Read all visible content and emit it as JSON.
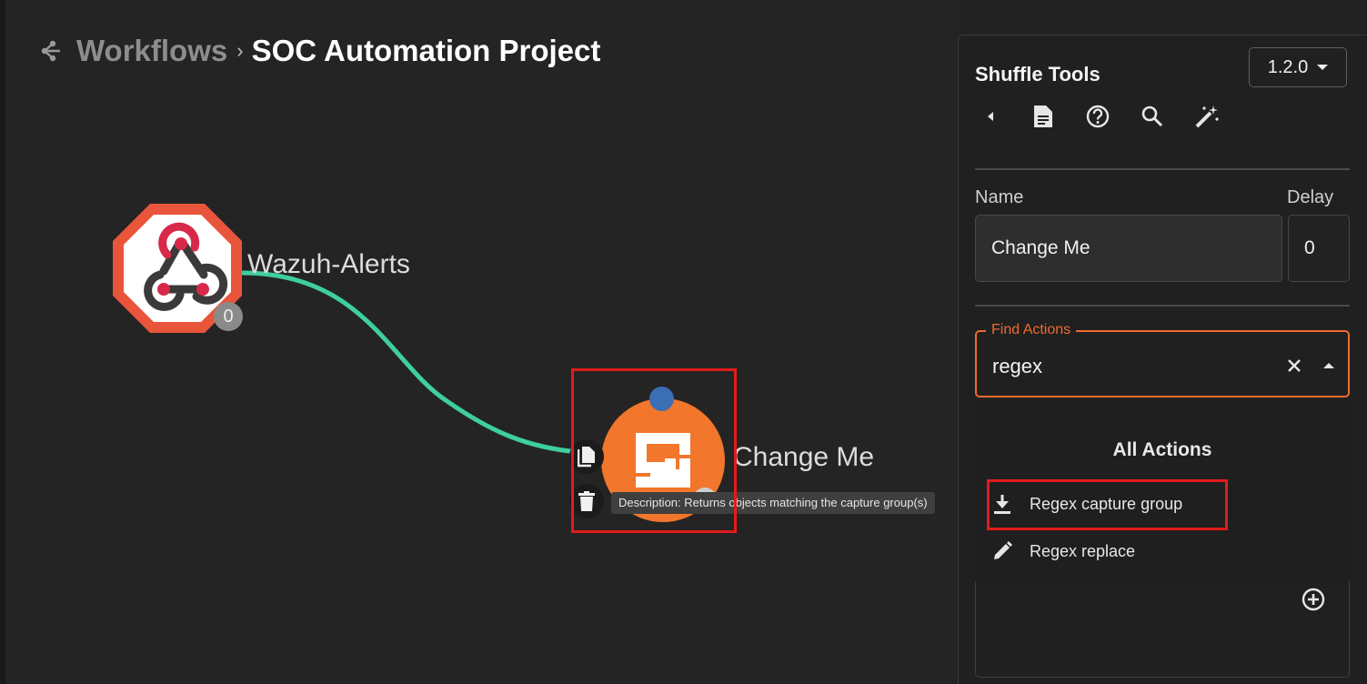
{
  "breadcrumb": {
    "icon": "workflow-icon",
    "root": "Workflows",
    "separator": "›",
    "current": "SOC Automation Project"
  },
  "graph": {
    "edge_color": "#3fcf9e",
    "trigger_node": {
      "icon": "webhook-icon",
      "label": "Wazuh-Alerts",
      "count": "0",
      "color": "#e9553b"
    },
    "action_node": {
      "icon": "shuffle-tools-logo",
      "label": "Change Me",
      "color": "#f2762b",
      "tooltip": "Description: Returns objects matching the capture group(s)"
    }
  },
  "panel": {
    "app_name": "Shuffle Tools",
    "version": "1.2.0",
    "toolbar": [
      "back-icon",
      "docs-icon",
      "help-icon",
      "search-icon",
      "magic-wand-icon"
    ],
    "name_label": "Name",
    "name_value": "Change Me",
    "delay_label": "Delay",
    "delay_value": "0",
    "find_actions_label": "Find Actions",
    "find_actions_value": "regex",
    "results_header": "All Actions",
    "results": [
      {
        "label": "Regex capture group",
        "icon": "download-icon"
      },
      {
        "label": "Regex replace",
        "icon": "pencil-icon"
      }
    ],
    "accent_color": "#f06a30",
    "highlight_color": "#e21b1b"
  }
}
